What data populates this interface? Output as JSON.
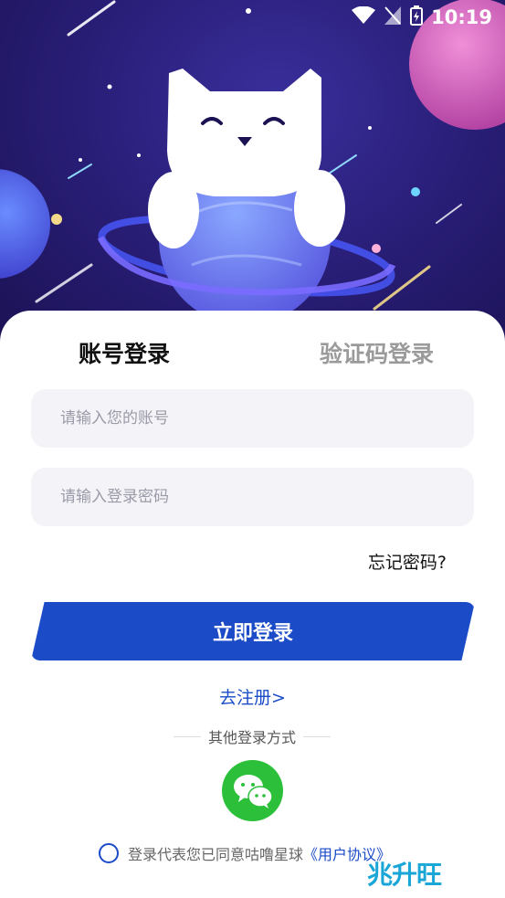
{
  "status": {
    "time": "10:19",
    "icons": [
      "wifi-icon",
      "no-signal-icon",
      "battery-icon"
    ]
  },
  "tabs": {
    "account": "账号登录",
    "code": "验证码登录"
  },
  "form": {
    "account_placeholder": "请输入您的账号",
    "password_placeholder": "请输入登录密码",
    "forgot": "忘记密码?",
    "login": "立即登录",
    "register": "去注册>"
  },
  "other": {
    "label": "其他登录方式",
    "icon": "wechat-icon"
  },
  "agreement": {
    "text": "登录代表您已同意咕噜星球",
    "link": "《用户协议》"
  },
  "watermark": "兆升旺",
  "colors": {
    "primary": "#1b4bc7",
    "hero_bg": "#2a1f7a",
    "wechat": "#2cc03a"
  }
}
